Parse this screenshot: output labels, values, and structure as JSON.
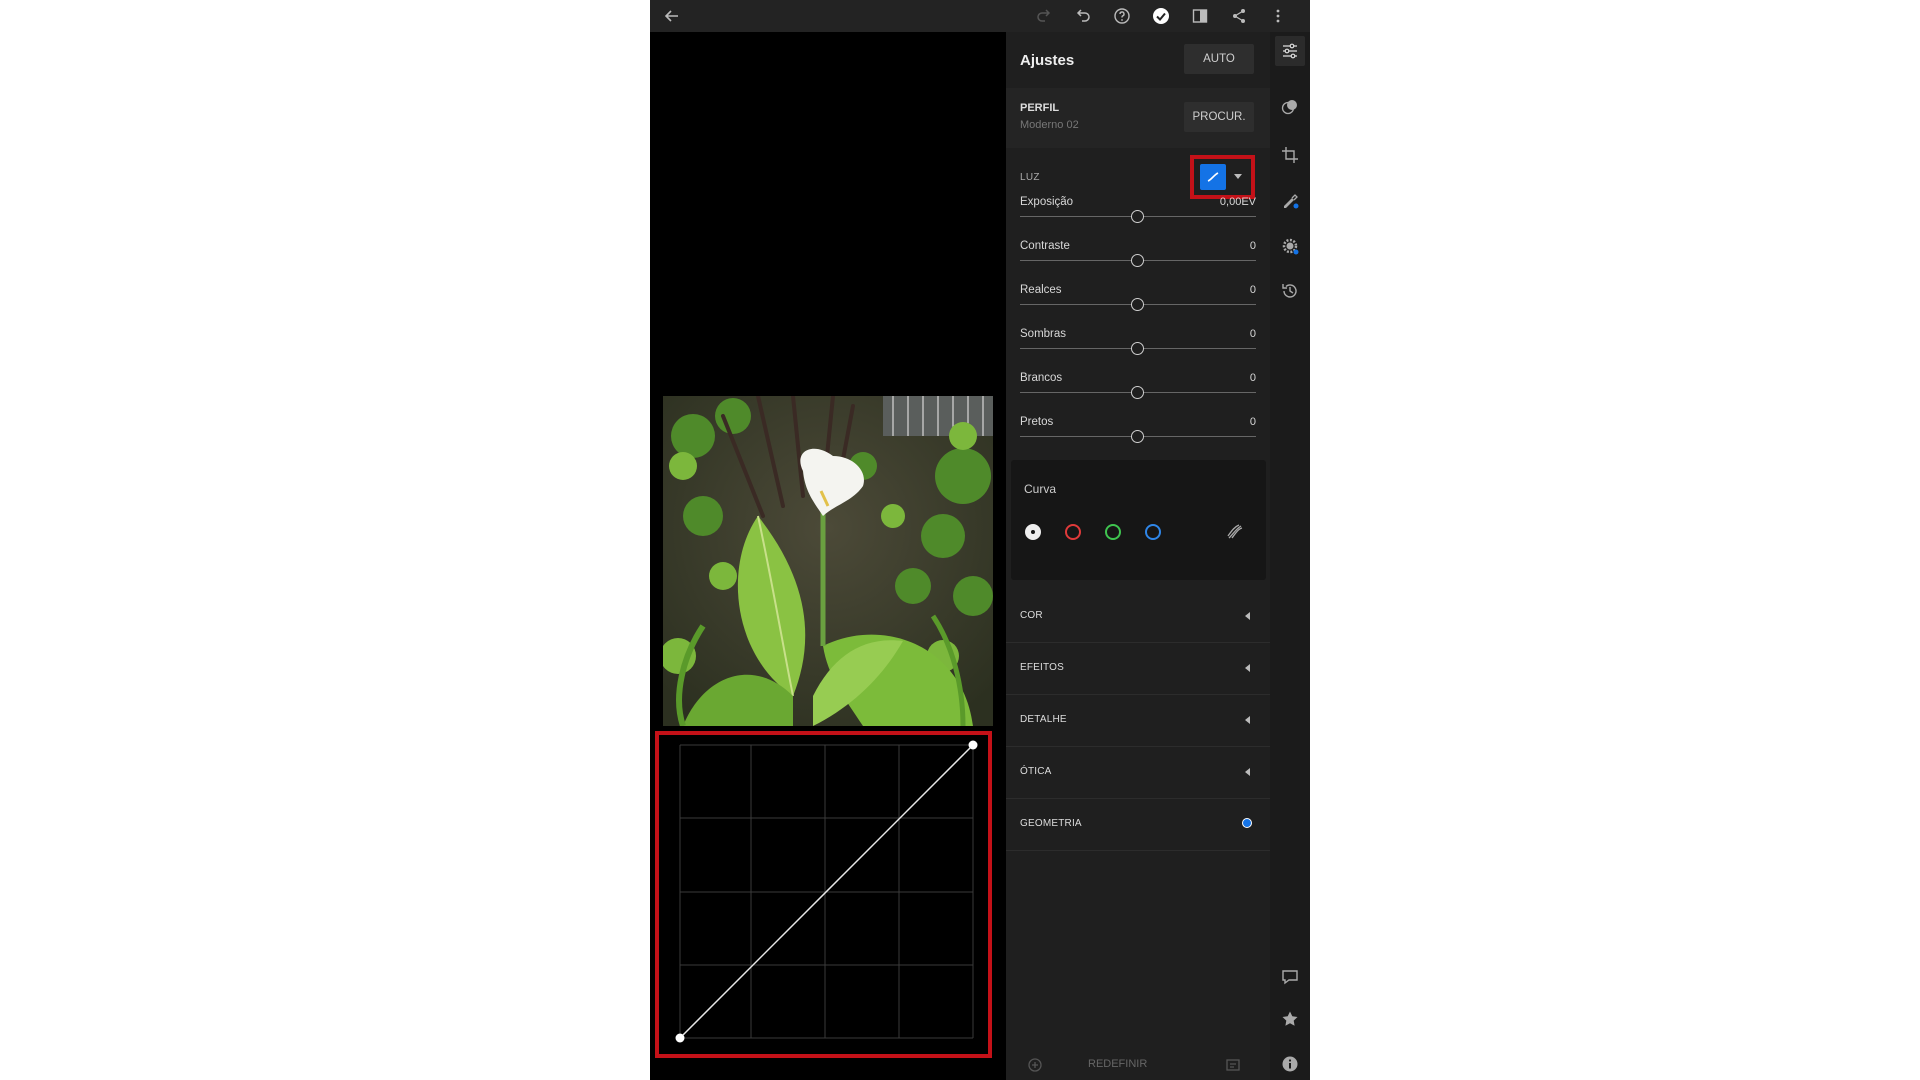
{
  "panel": {
    "title": "Ajustes",
    "auto_label": "AUTO",
    "profile": {
      "label": "PERFIL",
      "value": "Moderno 02",
      "browse_label": "PROCUR."
    },
    "light": {
      "label": "LUZ",
      "sliders": [
        {
          "name": "Exposição",
          "value": "0,00EV",
          "position": 0.5
        },
        {
          "name": "Contraste",
          "value": "0",
          "position": 0.5
        },
        {
          "name": "Realces",
          "value": "0",
          "position": 0.5
        },
        {
          "name": "Sombras",
          "value": "0",
          "position": 0.5
        },
        {
          "name": "Brancos",
          "value": "0",
          "position": 0.5
        },
        {
          "name": "Pretos",
          "value": "0",
          "position": 0.5
        }
      ]
    },
    "curve": {
      "title": "Curva",
      "channels": [
        {
          "name": "white",
          "color": "#eeeeee",
          "selected": true
        },
        {
          "name": "red",
          "color": "#e03a3a",
          "selected": false
        },
        {
          "name": "green",
          "color": "#3fc44f",
          "selected": false
        },
        {
          "name": "blue",
          "color": "#2f86e8",
          "selected": false
        }
      ]
    },
    "sections": [
      {
        "label": "COR"
      },
      {
        "label": "EFEITOS"
      },
      {
        "label": "DETALHE"
      },
      {
        "label": "ÓTICA"
      },
      {
        "label": "GEOMETRIA"
      }
    ],
    "footer": {
      "reset_label": "REDEFINIR"
    }
  },
  "colors": {
    "accent_blue": "#1473e6",
    "highlight_red": "#c41118"
  },
  "icons": {
    "top": [
      "back-arrow-icon",
      "redo-icon",
      "undo-icon",
      "help-icon",
      "done-check-icon",
      "compare-icon",
      "share-icon",
      "more-icon"
    ],
    "rail": [
      "adjust-sliders-icon",
      "presets-icon",
      "crop-icon",
      "healing-brush-icon",
      "selective-icon",
      "history-icon",
      "comment-icon",
      "star-icon",
      "info-icon"
    ]
  }
}
